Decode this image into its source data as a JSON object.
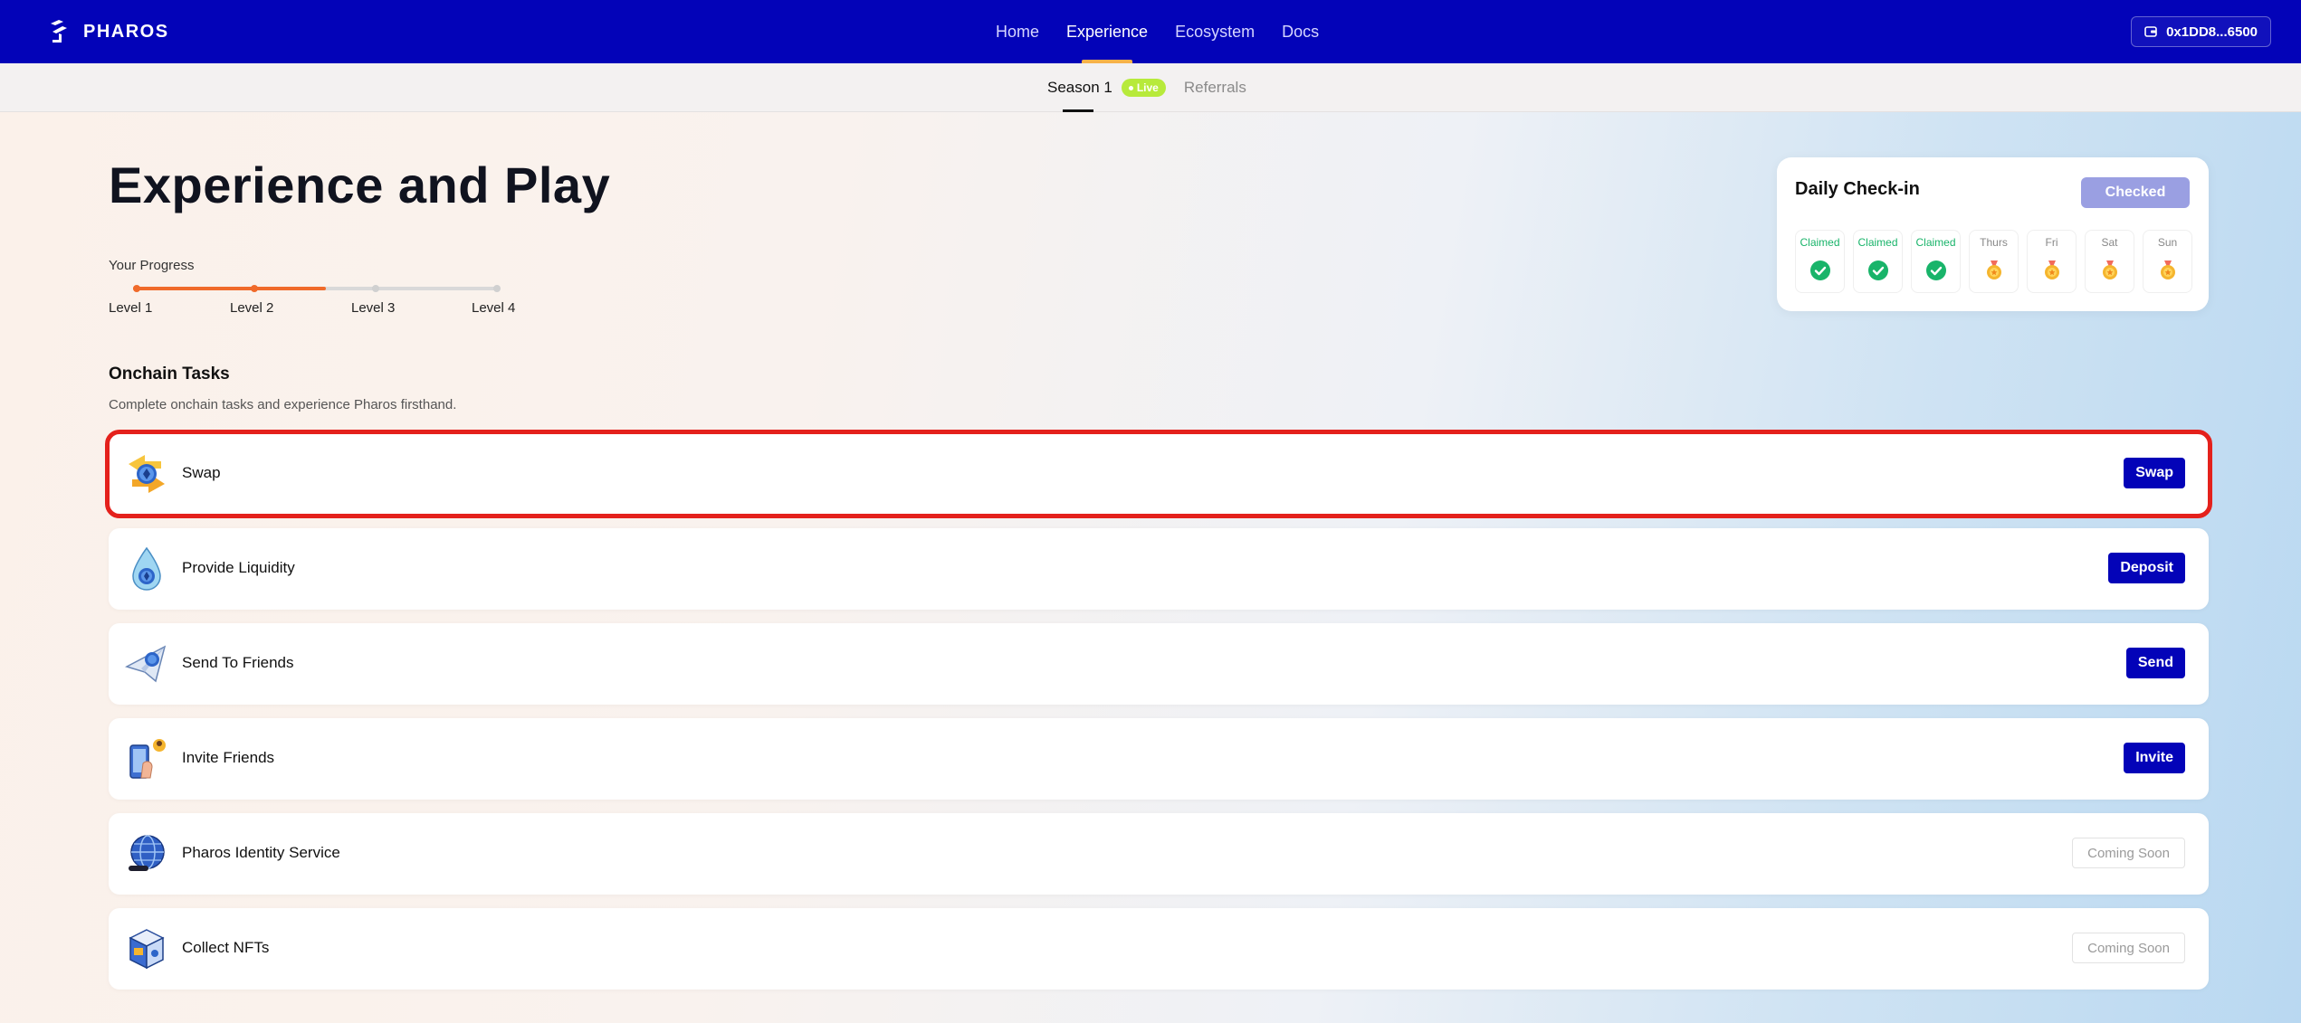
{
  "brand": {
    "name": "PHAROS"
  },
  "nav": {
    "items": [
      {
        "label": "Home",
        "active": false
      },
      {
        "label": "Experience",
        "active": true
      },
      {
        "label": "Ecosystem",
        "active": false
      },
      {
        "label": "Docs",
        "active": false
      }
    ]
  },
  "wallet": {
    "address": "0x1DD8...6500"
  },
  "subtabs": {
    "season": "Season 1",
    "live_badge": "Live",
    "referrals": "Referrals"
  },
  "page": {
    "title": "Experience and Play",
    "progress_label": "Your Progress",
    "progress_fraction": 0.53,
    "levels": [
      "Level 1",
      "Level 2",
      "Level 3",
      "Level 4"
    ]
  },
  "checkin": {
    "title": "Daily Check-in",
    "button": "Checked",
    "days": [
      {
        "label": "Claimed",
        "claimed": true
      },
      {
        "label": "Claimed",
        "claimed": true
      },
      {
        "label": "Claimed",
        "claimed": true
      },
      {
        "label": "Thurs",
        "claimed": false
      },
      {
        "label": "Fri",
        "claimed": false
      },
      {
        "label": "Sat",
        "claimed": false
      },
      {
        "label": "Sun",
        "claimed": false
      }
    ]
  },
  "tasks": {
    "title": "Onchain Tasks",
    "subtitle": "Complete onchain tasks and experience Pharos firsthand.",
    "items": [
      {
        "name": "Swap",
        "button": "Swap",
        "icon": "swap-icon",
        "highlighted": true
      },
      {
        "name": "Provide Liquidity",
        "button": "Deposit",
        "icon": "liquidity-drop-icon"
      },
      {
        "name": "Send To Friends",
        "button": "Send",
        "icon": "paper-plane-icon"
      },
      {
        "name": "Invite Friends",
        "button": "Invite",
        "icon": "invite-phone-icon"
      },
      {
        "name": "Pharos Identity Service",
        "button": "Coming Soon",
        "icon": "globe-icon"
      },
      {
        "name": "Collect NFTs",
        "button": "Coming Soon",
        "icon": "nft-box-icon"
      }
    ]
  },
  "colors": {
    "nav_bg": "#0303b8",
    "accent_orange": "#f06a2a",
    "claimed_green": "#19b46a",
    "highlight_red": "#e4211c"
  }
}
